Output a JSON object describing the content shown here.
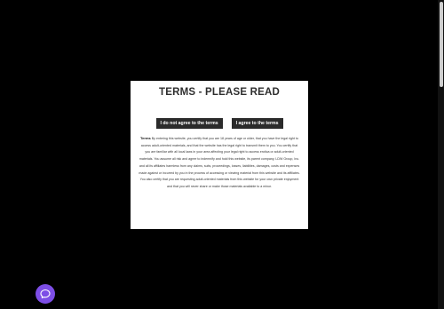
{
  "modal": {
    "title": "TERMS - PLEASE READ",
    "decline_label": "I do not agree to the terms",
    "accept_label": "I agree to the terms",
    "terms_heading": "Terms",
    "terms_body": "By entering this website, you certify that you are 18 years of age or older, that you have the legal right to access adult-oriented materials, and that the website has the legal right to transmit them to you. You certify that you are familiar with all local laws in your area affecting your legal right to access erotica or adult-oriented materials. You assume all risk and agree to indemnify and hold this website, its parent company, LDW Group, Inc. and all its affiliates harmless from any claims, suits, proceedings, losses, liabilities, damages, costs and expenses made against or incurred by you in the process of accessing or viewing material from this website and its affiliates. You also certify that you are requesting adult-oriented materials from this website for your own private enjoyment and that you will never share or make those materials available to a minor."
  },
  "chat_widget": {
    "icon": "chat-bubble-icon",
    "color": "#7d4ee6"
  }
}
